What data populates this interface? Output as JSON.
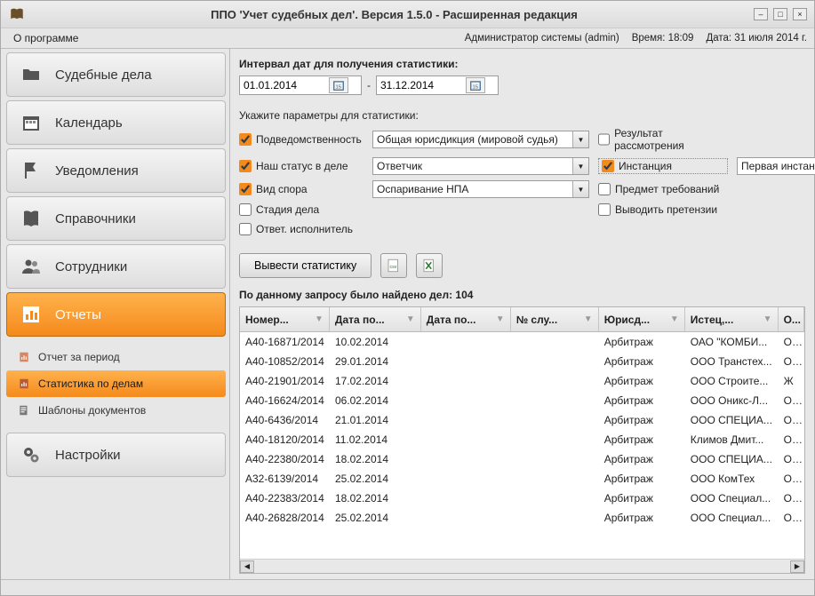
{
  "window": {
    "title": "ППО 'Учет судебных дел'. Версия 1.5.0 - Расширенная редакция"
  },
  "menu": {
    "about": "О программе"
  },
  "status": {
    "user": "Администратор системы (admin)",
    "time_label": "Время: 18:09",
    "date_label": "Дата: 31 июля 2014 г."
  },
  "sidebar": {
    "items": [
      {
        "label": "Судебные дела"
      },
      {
        "label": "Календарь"
      },
      {
        "label": "Уведомления"
      },
      {
        "label": "Справочники"
      },
      {
        "label": "Сотрудники"
      },
      {
        "label": "Отчеты"
      },
      {
        "label": "Настройки"
      }
    ],
    "sub_reports": [
      {
        "label": "Отчет за период"
      },
      {
        "label": "Статистика по делам"
      },
      {
        "label": "Шаблоны документов"
      }
    ]
  },
  "filters": {
    "date_section_title": "Интервал дат для получения статистики:",
    "date_from": "01.01.2014",
    "date_sep": "-",
    "date_to": "31.12.2014",
    "params_title": "Укажите параметры для статистики:",
    "jurisdiction_label": "Подведомственность",
    "jurisdiction_value": "Общая юрисдикция (мировой судья)",
    "result_label": "Результат рассмотрения",
    "status_label": "Наш статус в деле",
    "status_value": "Ответчик",
    "instance_label": "Инстанция",
    "instance_value": "Первая инстанция",
    "dispute_label": "Вид спора",
    "dispute_value": "Оспаривание НПА",
    "subject_label": "Предмет требований",
    "stage_label": "Стадия дела",
    "claims_label": "Выводить претензии",
    "responsible_label": "Ответ. исполнитель"
  },
  "actions": {
    "run": "Вывести статистику"
  },
  "results": {
    "summary": "По данному запросу было найдено дел: 104",
    "columns": [
      "Номер...",
      "Дата по...",
      "Дата по...",
      "№ слу...",
      "Юрисд...",
      "Истец,...",
      "О..."
    ],
    "rows": [
      {
        "num": "A40-16871/2014",
        "d1": "10.02.2014",
        "d2": "",
        "svc": "",
        "jur": "Арбитраж",
        "plaintiff": "ОАО \"КОМБИ...",
        "o": "ОС"
      },
      {
        "num": "A40-10852/2014",
        "d1": "29.01.2014",
        "d2": "",
        "svc": "",
        "jur": "Арбитраж",
        "plaintiff": "ООО Транстех...",
        "o": "ОС"
      },
      {
        "num": "A40-21901/2014",
        "d1": "17.02.2014",
        "d2": "",
        "svc": "",
        "jur": "Арбитраж",
        "plaintiff": "ООО Строите...",
        "o": "Ж"
      },
      {
        "num": "A40-16624/2014",
        "d1": "06.02.2014",
        "d2": "",
        "svc": "",
        "jur": "Арбитраж",
        "plaintiff": "ООО Оникс-Л...",
        "o": "ОС"
      },
      {
        "num": "A40-6436/2014",
        "d1": "21.01.2014",
        "d2": "",
        "svc": "",
        "jur": "Арбитраж",
        "plaintiff": "ООО СПЕЦИА...",
        "o": "ОС"
      },
      {
        "num": "A40-18120/2014",
        "d1": "11.02.2014",
        "d2": "",
        "svc": "",
        "jur": "Арбитраж",
        "plaintiff": "Климов Дмит...",
        "o": "ОС"
      },
      {
        "num": "A40-22380/2014",
        "d1": "18.02.2014",
        "d2": "",
        "svc": "",
        "jur": "Арбитраж",
        "plaintiff": "ООО СПЕЦИА...",
        "o": "ОС"
      },
      {
        "num": "A32-6139/2014",
        "d1": "25.02.2014",
        "d2": "",
        "svc": "",
        "jur": "Арбитраж",
        "plaintiff": "ООО КомТех",
        "o": "ОС"
      },
      {
        "num": "A40-22383/2014",
        "d1": "18.02.2014",
        "d2": "",
        "svc": "",
        "jur": "Арбитраж",
        "plaintiff": "ООО Специал...",
        "o": "ОС"
      },
      {
        "num": "A40-26828/2014",
        "d1": "25.02.2014",
        "d2": "",
        "svc": "",
        "jur": "Арбитраж",
        "plaintiff": "ООО Специал...",
        "o": "ОС"
      }
    ]
  }
}
